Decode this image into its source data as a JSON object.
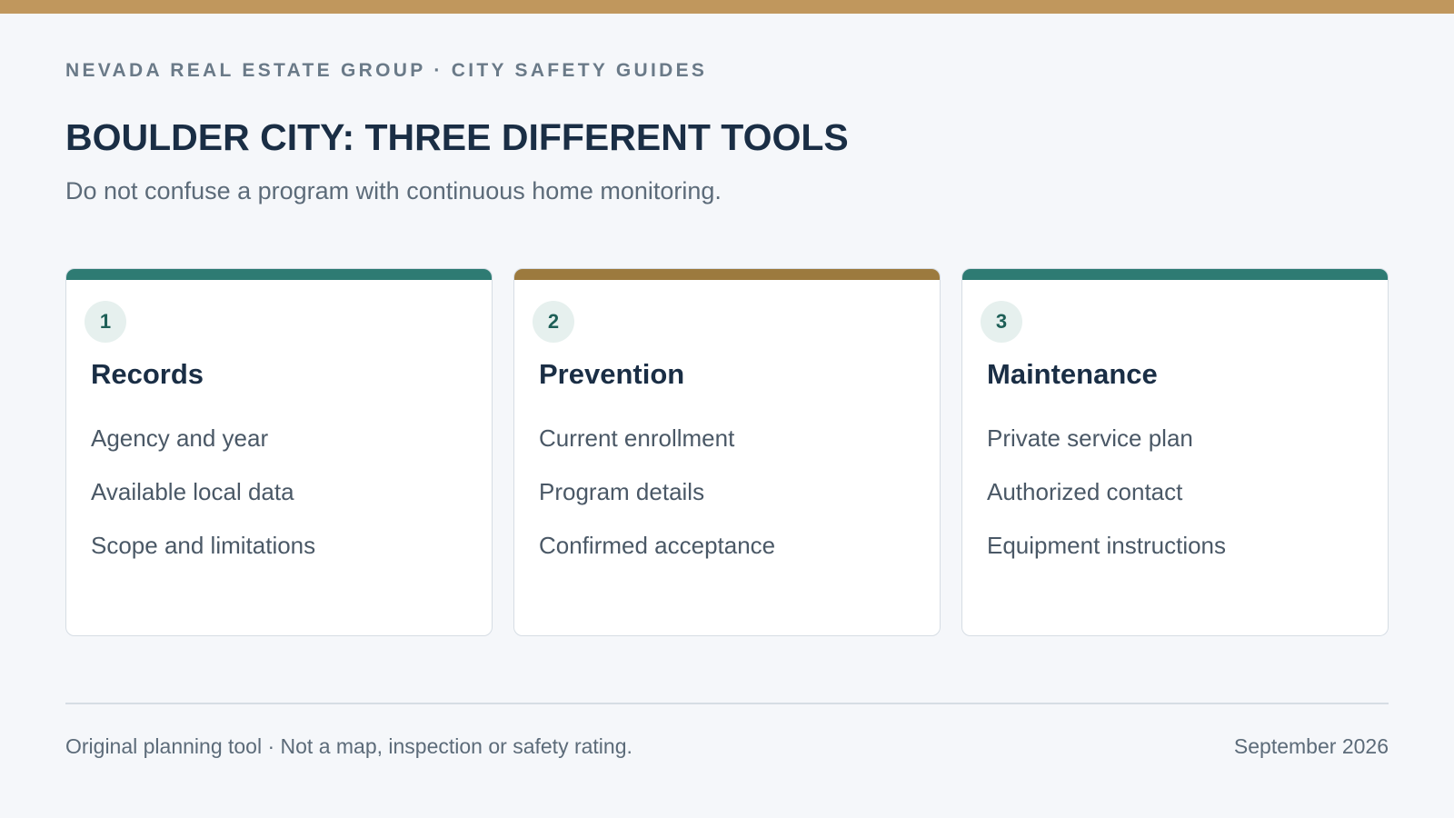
{
  "header": {
    "eyebrow": "NEVADA REAL ESTATE GROUP · CITY SAFETY GUIDES",
    "title": "BOULDER CITY: THREE DIFFERENT TOOLS",
    "subtitle": "Do not confuse a program with continuous home monitoring."
  },
  "colors": {
    "top_bar": "#c0975d",
    "teal_accent": "#2e7b73",
    "gold_accent": "#9c7a3e"
  },
  "cards": [
    {
      "number": "1",
      "title": "Records",
      "accent": "#2e7b73",
      "items": [
        "Agency and year",
        "Available local data",
        "Scope and limitations"
      ]
    },
    {
      "number": "2",
      "title": "Prevention",
      "accent": "#9c7a3e",
      "items": [
        "Current enrollment",
        "Program details",
        "Confirmed acceptance"
      ]
    },
    {
      "number": "3",
      "title": "Maintenance",
      "accent": "#2e7b73",
      "items": [
        "Private service plan",
        "Authorized contact",
        "Equipment instructions"
      ]
    }
  ],
  "footer": {
    "note": "Original planning tool · Not a map, inspection or safety rating.",
    "date": "September 2026"
  }
}
